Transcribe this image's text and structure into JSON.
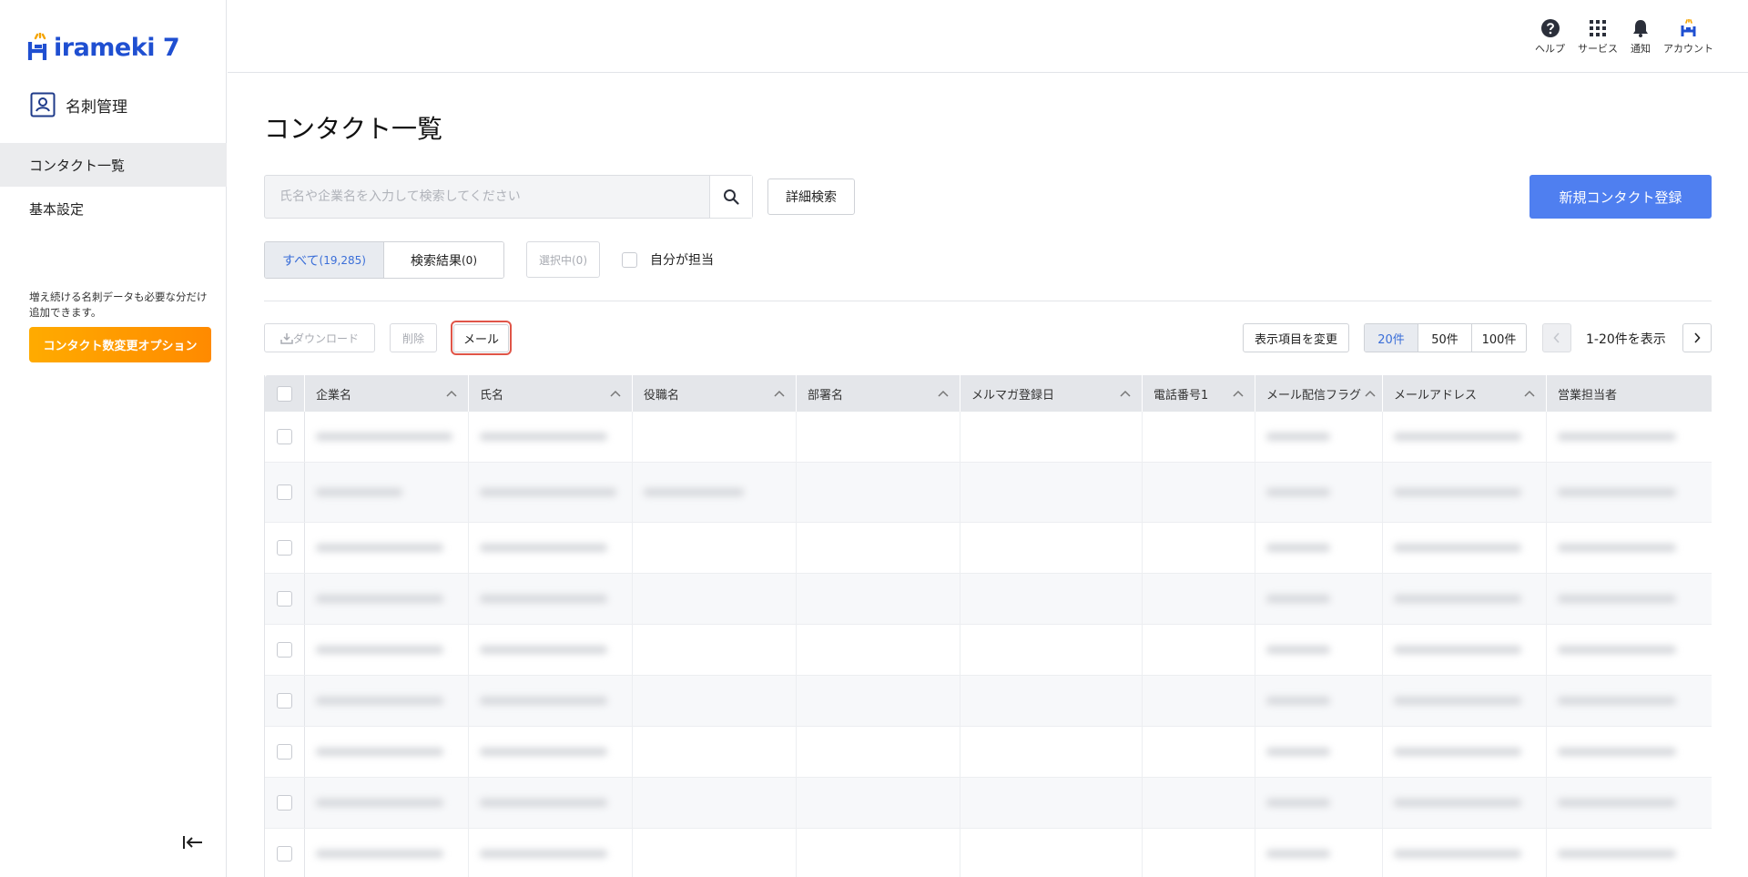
{
  "brand": {
    "logo_text": "irameki 7",
    "accent": "#1f4fd1"
  },
  "sidebar": {
    "section_title": "名刺管理",
    "items": [
      {
        "label": "コンタクト一覧",
        "active": true
      },
      {
        "label": "基本設定",
        "active": false
      }
    ],
    "promo_text": "増え続ける名刺データも必要な分だけ追加できます。",
    "promo_button": "コンタクト数変更オプション"
  },
  "header": {
    "icons": [
      {
        "icon": "help-icon",
        "label": "ヘルプ"
      },
      {
        "icon": "grid-icon",
        "label": "サービス"
      },
      {
        "icon": "bell-icon",
        "label": "通知"
      },
      {
        "icon": "account-icon",
        "label": "アカウント"
      }
    ]
  },
  "main": {
    "title": "コンタクト一覧",
    "search_placeholder": "氏名や企業名を入力して検索してください",
    "advanced_search": "詳細検索",
    "new_contact": "新規コンタクト登録",
    "tabs": {
      "all_label": "すべて",
      "all_count": "(19,285)",
      "results_label": "検索結果",
      "results_count": "(0)"
    },
    "selected": "選択中(0)",
    "mine_label": "自分が担当",
    "toolbar": {
      "download": "ダウンロード",
      "delete": "削除",
      "mail": "メール",
      "change_columns": "表示項目を変更"
    },
    "page_sizes": [
      "20件",
      "50件",
      "100件"
    ],
    "range_text": "1-20件を表示"
  },
  "table": {
    "columns": [
      "企業名",
      "氏名",
      "役職名",
      "部署名",
      "メルマガ登録日",
      "電話番号1",
      "メール配信フラグ",
      "メールアドレス",
      "営業担当者"
    ]
  },
  "colors": {
    "primary": "#4f7ff0",
    "orange": "#ff9a00",
    "highlight": "#e05548"
  }
}
